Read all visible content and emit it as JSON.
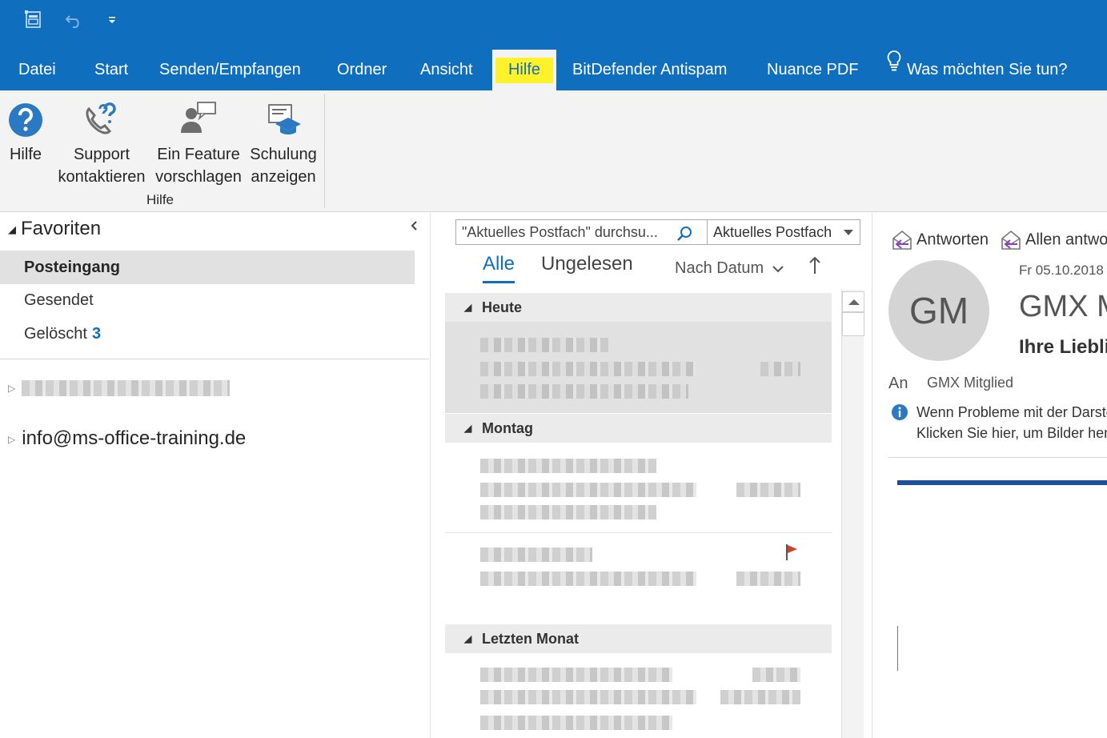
{
  "title_bar": {
    "qat": [
      "send-receive-icon",
      "undo-icon",
      "customize-qat-icon"
    ],
    "tabs": [
      "Datei",
      "Start",
      "Senden/Empfangen",
      "Ordner",
      "Ansicht",
      "Hilfe",
      "BitDefender Antispam",
      "Nuance PDF"
    ],
    "active_tab": "Hilfe",
    "tell_me": "Was möchten Sie tun?"
  },
  "ribbon": {
    "buttons": [
      {
        "icon": "help-icon",
        "lines": [
          "Hilfe"
        ]
      },
      {
        "icon": "support-phone-icon",
        "lines": [
          "Support",
          "kontaktieren"
        ]
      },
      {
        "icon": "feature-suggest-icon",
        "lines": [
          "Ein Feature",
          "vorschlagen"
        ]
      },
      {
        "icon": "training-icon",
        "lines": [
          "Schulung",
          "anzeigen"
        ]
      }
    ],
    "group_label": "Hilfe"
  },
  "folders": {
    "favorites_label": "Favoriten",
    "items": [
      {
        "name": "Posteingang",
        "selected": true
      },
      {
        "name": "Gesendet"
      },
      {
        "name": "Gelöscht",
        "count": "3"
      }
    ],
    "account2": "info@ms-office-training.de"
  },
  "list": {
    "search_placeholder": "\"Aktuelles Postfach\" durchsu...",
    "scope": "Aktuelles Postfach",
    "filters": [
      "Alle",
      "Ungelesen"
    ],
    "sort_label": "Nach Datum",
    "groups": [
      "Heute",
      "Montag",
      "Letzten Monat"
    ]
  },
  "reading": {
    "reply": "Antworten",
    "reply_all": "Allen antworten",
    "initials": "GM",
    "date": "Fr 05.10.2018",
    "sender": "GMX Magazin",
    "subject": "Ihre Lieblingsthemen",
    "to_label": "An",
    "to_value": "GMX Mitglied",
    "info_line1": "Wenn Probleme mit der Darstellung",
    "info_line2": "Klicken Sie hier, um Bilder herunterzuladen"
  },
  "colors": {
    "brand": "#106ebe",
    "highlight": "#fff22a",
    "selected_bg": "#e1e1e1"
  }
}
